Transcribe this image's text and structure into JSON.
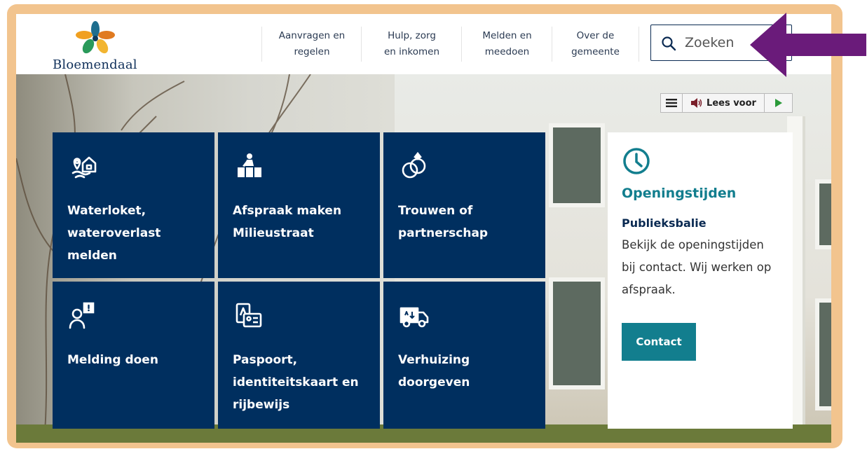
{
  "site": {
    "logo_text": "Bloemendaal"
  },
  "nav": {
    "items": [
      {
        "line1": "Aanvragen en",
        "line2": "regelen"
      },
      {
        "line1": "Hulp, zorg",
        "line2": "en inkomen"
      },
      {
        "line1": "Melden en",
        "line2": "meedoen"
      },
      {
        "line1": "Over de",
        "line2": "gemeente"
      }
    ]
  },
  "search": {
    "placeholder": "Zoeken"
  },
  "readspeaker": {
    "label": "Lees voor"
  },
  "tiles": [
    {
      "label": "Waterloket, wateroverlast melden",
      "icon": "water-location-icon"
    },
    {
      "label": "Afspraak maken Milieustraat",
      "icon": "recycling-person-icon"
    },
    {
      "label": "Trouwen of partnerschap",
      "icon": "rings-icon"
    },
    {
      "label": "Melding doen",
      "icon": "person-alert-icon"
    },
    {
      "label": "Paspoort, identiteitskaart en rijbewijs",
      "icon": "id-document-icon"
    },
    {
      "label": "Verhuizing doorgeven",
      "icon": "moving-truck-icon"
    }
  ],
  "opening": {
    "title": "Openingstijden",
    "subtitle": "Publieksbalie",
    "text": "Bekijk de openingstijden bij contact. Wij werken op afspraak.",
    "button": "Contact"
  },
  "colors": {
    "frame": "#f2c48e",
    "tile": "#002f5f",
    "accent": "#127e8e",
    "arrow": "#6a1b7a"
  }
}
